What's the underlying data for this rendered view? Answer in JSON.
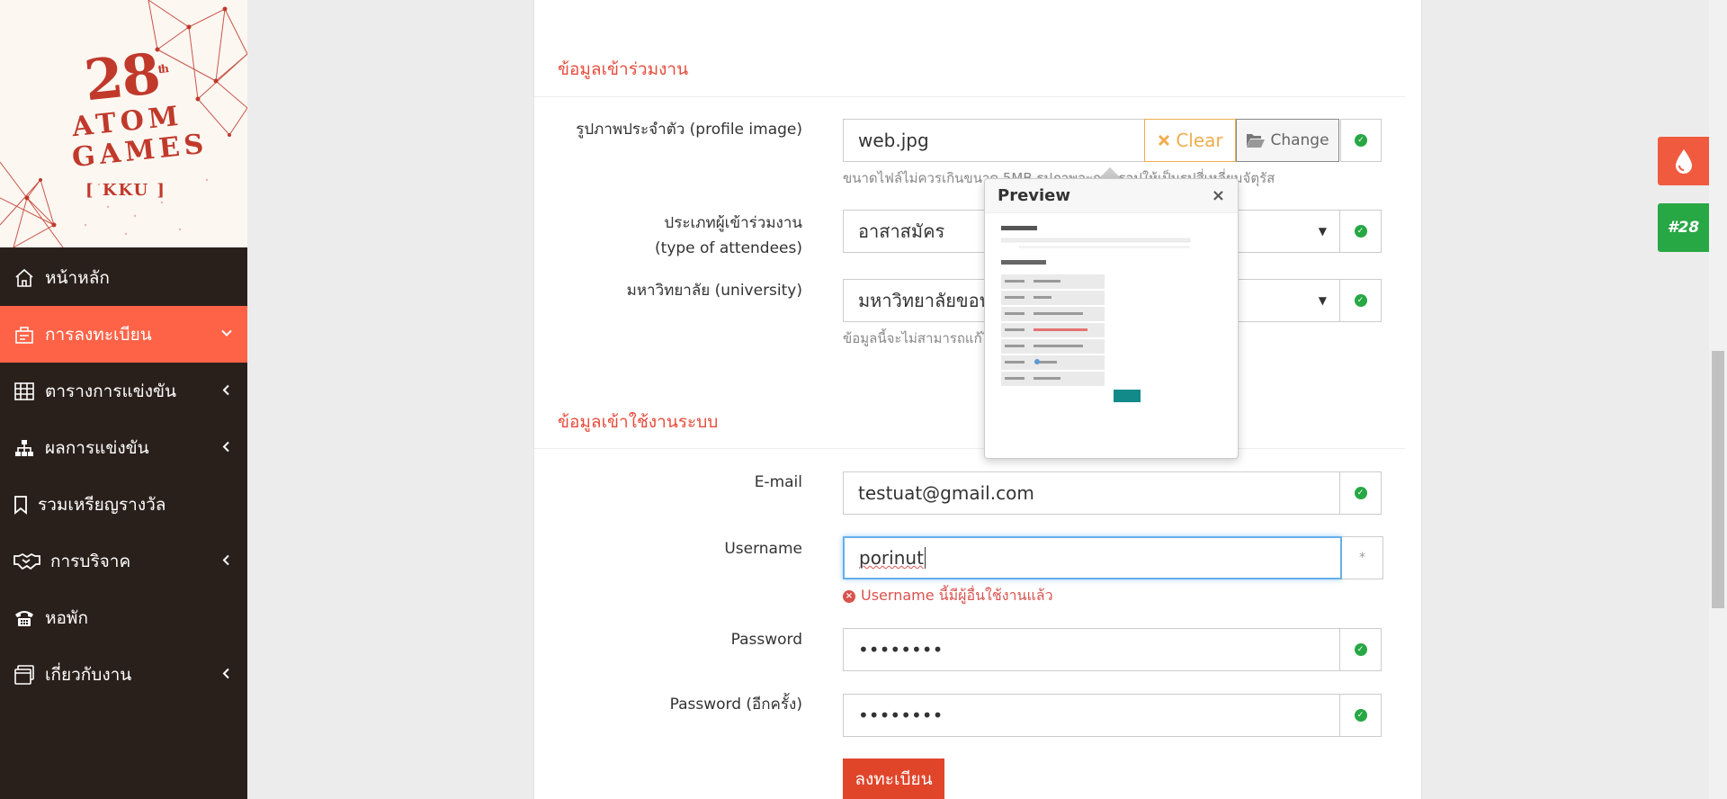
{
  "logo": {
    "number": "28",
    "suffix": "th",
    "line1": "ATOM",
    "line2": "GAMES",
    "kku": "[ KKU ]"
  },
  "sidebar": {
    "items": [
      {
        "label": "หน้าหลัก",
        "icon": "home-icon",
        "chevron": ""
      },
      {
        "label": "การลงทะเบียน",
        "icon": "register-icon",
        "chevron": "⌄"
      },
      {
        "label": "ตารางการแข่งขัน",
        "icon": "table-icon",
        "chevron": "‹"
      },
      {
        "label": "ผลการแข่งขัน",
        "icon": "sitemap-icon",
        "chevron": "‹"
      },
      {
        "label": "รวมเหรียญรางวัล",
        "icon": "bookmark-icon",
        "chevron": ""
      },
      {
        "label": "การบริจาค",
        "icon": "handshake-icon",
        "chevron": "‹"
      },
      {
        "label": "หอพัก",
        "icon": "phone-icon",
        "chevron": ""
      },
      {
        "label": "เกี่ยวกับงาน",
        "icon": "window-icon",
        "chevron": "‹"
      }
    ]
  },
  "attend": {
    "title": "ข้อมูลเข้าร่วมงาน",
    "profile_label": "รูปภาพประจำตัว (profile image)",
    "profile_value": "web.jpg",
    "clear_label": "Clear",
    "change_label": "Change",
    "profile_help": "ขนาดไฟล์ไม่ควรเกินขนาด 5MB รูปภาพจะถูกครอปให้เป็นรูปสี่เหลี่ยมจัตุรัส",
    "type_label_1": "ประเภทผู้เข้าร่วมงาน",
    "type_label_2": "(type of attendees)",
    "type_value": "อาสาสมัคร",
    "univ_label": "มหาวิทยาลัย (university)",
    "univ_value": "มหาวิทยาลัยขอนแก่น",
    "univ_help": "ข้อมูลนี้จะไม่สามารถแก้ไขได้"
  },
  "preview": {
    "title": "Preview",
    "close": "×"
  },
  "account": {
    "title": "ข้อมูลเข้าใช้งานระบบ",
    "email_label": "E-mail",
    "email_value": "testuat@gmail.com",
    "username_label": "Username",
    "username_value": "porinut",
    "username_required": "*",
    "username_error": "Username นี้มีผู้อื่นใช้งานแล้ว",
    "password_label": "Password",
    "password_value": "••••••••",
    "password2_label": "Password (อีกครั้ง)",
    "password2_value": "••••••••",
    "submit_label": "ลงทะเบียน"
  },
  "float": {
    "green_label": "#28"
  },
  "colors": {
    "accent": "#ff6347",
    "sidebar": "#2a201b",
    "success": "#28a745",
    "danger": "#d9534f",
    "warning": "#f0ad4e"
  }
}
